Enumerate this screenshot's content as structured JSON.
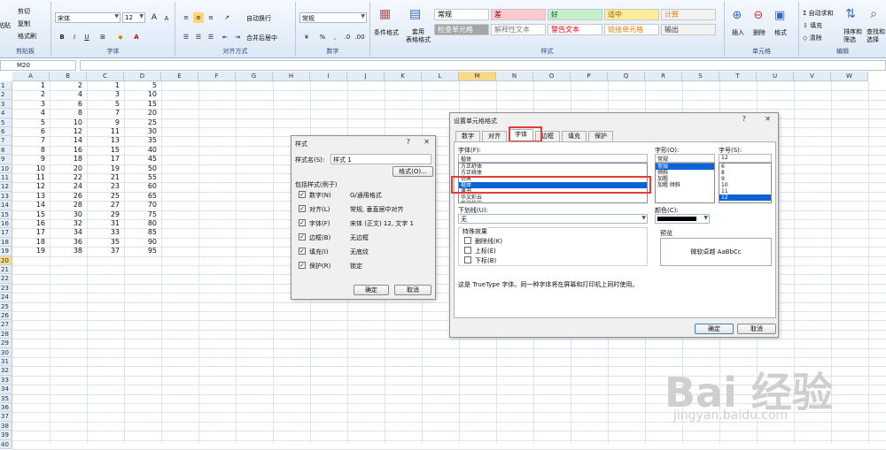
{
  "ribbon": {
    "clipboard": {
      "cut": "剪切",
      "copy": "复制",
      "painter": "格式刷",
      "paste": "粘贴",
      "label": "剪贴板"
    },
    "font": {
      "name": "宋体",
      "size": "12",
      "label": "字体",
      "grow": "A",
      "shrink": "A",
      "bold": "B",
      "italic": "I",
      "underline": "U"
    },
    "align": {
      "label": "对齐方式",
      "wrap": "自动换行",
      "merge": "合并后居中"
    },
    "number": {
      "format": "常规",
      "label": "数字",
      "percent": "%",
      "comma": ","
    },
    "styles": {
      "cond": "条件格式",
      "table": "套用\n表格格式",
      "label": "样式",
      "items": [
        {
          "text": "常规",
          "color": "#ffffff",
          "fg": "#000000"
        },
        {
          "text": "差",
          "color": "#ffc7ce",
          "fg": "#9c0006"
        },
        {
          "text": "好",
          "color": "#c6efce",
          "fg": "#006100"
        },
        {
          "text": "适中",
          "color": "#ffeb9c",
          "fg": "#9c6500"
        },
        {
          "text": "计算",
          "color": "#f2f2f2",
          "fg": "#fa7d00"
        },
        {
          "text": "检查单元格",
          "color": "#a5a5a5",
          "fg": "#ffffff"
        },
        {
          "text": "解释性文本",
          "color": "#ffffff",
          "fg": "#7f7f7f"
        },
        {
          "text": "警告文本",
          "color": "#ffffff",
          "fg": "#ff0000"
        },
        {
          "text": "链接单元格",
          "color": "#ffffff",
          "fg": "#fa7d00"
        },
        {
          "text": "输出",
          "color": "#f2f2f2",
          "fg": "#3f3f3f"
        }
      ]
    },
    "cells": {
      "insert": "插入",
      "delete": "删除",
      "format": "格式",
      "label": "单元格"
    },
    "edit": {
      "autosum": "自动求和",
      "fill": "填充",
      "clear": "清除",
      "sort": "排序和\n筛选",
      "find": "查找和\n选择",
      "label": "编辑"
    }
  },
  "namebox": "M20",
  "columns": [
    "A",
    "B",
    "C",
    "D",
    "E",
    "F",
    "G",
    "H",
    "I",
    "J",
    "K",
    "L",
    "M",
    "N",
    "O",
    "P",
    "Q",
    "R",
    "S",
    "T",
    "U",
    "V",
    "W"
  ],
  "rows": [
    [
      1,
      2,
      1,
      5
    ],
    [
      2,
      4,
      3,
      10
    ],
    [
      3,
      6,
      5,
      15
    ],
    [
      4,
      8,
      7,
      20
    ],
    [
      5,
      10,
      9,
      25
    ],
    [
      6,
      12,
      11,
      30
    ],
    [
      7,
      14,
      13,
      35
    ],
    [
      8,
      16,
      15,
      40
    ],
    [
      9,
      18,
      17,
      45
    ],
    [
      10,
      20,
      19,
      50
    ],
    [
      11,
      22,
      21,
      55
    ],
    [
      12,
      24,
      23,
      60
    ],
    [
      13,
      26,
      25,
      65
    ],
    [
      14,
      28,
      27,
      70
    ],
    [
      15,
      30,
      29,
      75
    ],
    [
      16,
      32,
      31,
      80
    ],
    [
      17,
      34,
      33,
      85
    ],
    [
      18,
      36,
      35,
      90
    ],
    [
      19,
      38,
      37,
      95
    ]
  ],
  "row_numbers": [
    "1",
    "2",
    "3",
    "4",
    "5",
    "6",
    "7",
    "8",
    "9",
    "10",
    "11",
    "12",
    "13",
    "14",
    "15",
    "16",
    "17",
    "18",
    "19",
    "20",
    "21",
    "22",
    "23",
    "24",
    "25",
    "26",
    "27",
    "28",
    "29",
    "30",
    "31",
    "32",
    "33",
    "34",
    "35",
    "36",
    "37",
    "38",
    "39",
    "40"
  ],
  "style_dialog": {
    "title": "样式",
    "help": "?",
    "close": "✕",
    "name_label": "样式名(S):",
    "name_value": "样式 1",
    "format_btn": "格式(O)...",
    "includes": "包括样式(例子)",
    "items": [
      {
        "k": "数字(N)",
        "v": "G/通用格式"
      },
      {
        "k": "对齐(L)",
        "v": "常规, 垂直居中对齐"
      },
      {
        "k": "字体(F)",
        "v": "宋体 (正文) 12, 文字 1"
      },
      {
        "k": "边框(B)",
        "v": "无边框"
      },
      {
        "k": "填充(I)",
        "v": "无底纹"
      },
      {
        "k": "保护(R)",
        "v": "锁定"
      }
    ],
    "ok": "确定",
    "cancel": "取消"
  },
  "format_dialog": {
    "title": "设置单元格格式",
    "help": "?",
    "close": "✕",
    "tabs": [
      "数字",
      "对齐",
      "字体",
      "边框",
      "填充",
      "保护"
    ],
    "font_label": "字体(F):",
    "font_value": "楷体",
    "fonts": [
      "方正舒体",
      "方正姚体",
      "仿宋",
      "楷体",
      "隶书",
      "华文彩云",
      "华文仿宋"
    ],
    "style_label": "字形(O):",
    "style_value": "常规",
    "styles": [
      "常规",
      "倾斜",
      "加粗",
      "加粗 倾斜"
    ],
    "size_label": "字号(S):",
    "size_value": "12",
    "sizes": [
      "6",
      "8",
      "9",
      "10",
      "11",
      "12"
    ],
    "underline_label": "下划线(U):",
    "underline_value": "无",
    "color_label": "颜色(C):",
    "effects_label": "特殊效果",
    "effects": [
      "删除线(K)",
      "上标(E)",
      "下标(B)"
    ],
    "preview_label": "预览",
    "preview_text": "微软卓越  AaBbCc",
    "note": "这是 TrueType 字体。同一种字体将在屏幕和打印机上同时使用。",
    "ok": "确定",
    "cancel": "取消"
  },
  "watermark": {
    "big": "Bai 经验",
    "small": "jingyan.baidu.com"
  }
}
